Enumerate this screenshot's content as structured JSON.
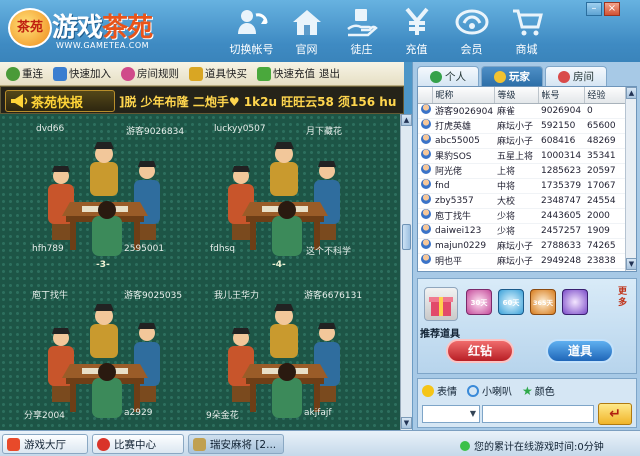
{
  "app": {
    "logo_badge": "茶苑",
    "logo_title_a": "游戏",
    "logo_title_b": "茶苑",
    "logo_url": "WWW.GAMETEA.COM"
  },
  "nav": [
    {
      "label": "切换帐号",
      "icon": "switch-account-icon"
    },
    {
      "label": "官网",
      "icon": "home-icon"
    },
    {
      "label": "徒庄",
      "icon": "shop-hand-icon"
    },
    {
      "label": "充值",
      "icon": "recharge-icon"
    },
    {
      "label": "会员",
      "icon": "member-icon"
    },
    {
      "label": "商城",
      "icon": "cart-icon"
    }
  ],
  "window_controls": {
    "minimize": "–",
    "close": "×"
  },
  "toolbar": {
    "items": [
      {
        "label": "重连",
        "icon": "reconnect-icon",
        "color": "#4a9a38"
      },
      {
        "label": "快速加入",
        "icon": "quick-join-icon",
        "color": "#3a7ed0"
      },
      {
        "label": "房间规则",
        "icon": "room-rules-icon",
        "color": "#d04a8a"
      },
      {
        "label": "道具快买",
        "icon": "prop-buy-icon",
        "color": "#d9a623"
      },
      {
        "label": "快速充值",
        "icon": "quick-recharge-icon",
        "color": "#4aa83c"
      }
    ],
    "exit_label": "退出"
  },
  "ticker": {
    "label": "茶苑快报",
    "text": "]脱  少年布隆  二炮手♥  1k2u  旺旺云58  须156  hu"
  },
  "room": {
    "tables": [
      {
        "players": {
          "top_left": "dvd66",
          "top_right": "游客9026834",
          "bottom_left": "hfh789",
          "bottom_right": "2595001"
        },
        "number": "-3-"
      },
      {
        "players": {
          "top_left": "luckyy0507",
          "top_right": "月下藏花",
          "bottom_left": "fdhsq",
          "bottom_right": "这个不科学"
        },
        "number": "-4-"
      },
      {
        "players": {
          "top_left": "庖丁找牛",
          "top_right": "游客9025035",
          "bottom_left": "分享2004",
          "bottom_right": "a2929"
        },
        "number": ""
      },
      {
        "players": {
          "top_left": "我儿王华力",
          "top_right": "游客6676131",
          "bottom_left": "9朵金花",
          "bottom_right": "akjfajf"
        },
        "number": ""
      }
    ]
  },
  "right_tabs": [
    {
      "label": "个人",
      "active": false,
      "color": "#35a14a"
    },
    {
      "label": "玩家",
      "active": true,
      "color": "#f2c230"
    },
    {
      "label": "房间",
      "active": false,
      "color": "#d94a4a"
    }
  ],
  "player_table": {
    "columns": [
      "昵称",
      "等级",
      "帐号",
      "经验"
    ],
    "rows": [
      [
        "游客9026904",
        "麻雀",
        "9026904",
        "0"
      ],
      [
        "打虎英雄",
        "麻坛小子",
        "592150",
        "65600"
      ],
      [
        "abc55005",
        "麻坛小子",
        "608416",
        "48269"
      ],
      [
        "果豹SOS",
        "五星上将",
        "1000314",
        "35341"
      ],
      [
        "阿光佬",
        "上将",
        "1285623",
        "20597"
      ],
      [
        "fnd",
        "中将",
        "1735379",
        "17067"
      ],
      [
        "zby5357",
        "大校",
        "2348747",
        "24554"
      ],
      [
        "庖丁找牛",
        "少将",
        "2443605",
        "2000"
      ],
      [
        "daiwei123",
        "少将",
        "2457257",
        "1909"
      ],
      [
        "majun0229",
        "麻坛小子",
        "2788633",
        "74265"
      ],
      [
        "明也平",
        "麻坛小子",
        "2949248",
        "23838"
      ]
    ]
  },
  "promo": {
    "title": "推荐道具",
    "more_label": "更多",
    "prop_badges": [
      "30天",
      "60天",
      "365天"
    ],
    "red_button": "红钻",
    "blue_button": "道具"
  },
  "chat": {
    "emoji_label": "表情",
    "horn_label": "小喇叭",
    "color_label": "颜色",
    "input_value": "",
    "send_icon": "send-arrow-icon"
  },
  "statusbar": {
    "tabs": [
      {
        "label": "游戏大厅",
        "icon": "lobby-icon"
      },
      {
        "label": "比赛中心",
        "icon": "match-icon"
      },
      {
        "label": "瑞安麻将 [2...",
        "icon": "mahjong-icon"
      }
    ],
    "online_text": "您的累计在线游戏时间:0分钟"
  }
}
